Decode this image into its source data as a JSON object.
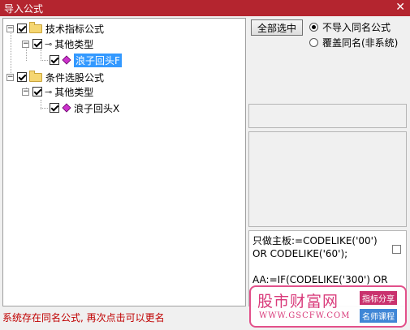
{
  "window": {
    "title": "导入公式",
    "close_glyph": "✕"
  },
  "tree": {
    "nodes": [
      {
        "label": "技术指标公式",
        "checked": true
      },
      {
        "label": "其他类型",
        "checked": true
      },
      {
        "label": "浪子回头F",
        "checked": true,
        "selected": true
      },
      {
        "label": "条件选股公式",
        "checked": true
      },
      {
        "label": "其他类型",
        "checked": true
      },
      {
        "label": "浪子回头X",
        "checked": true
      }
    ],
    "collapse_glyph": "−"
  },
  "buttons": {
    "select_all": "全部选中"
  },
  "radios": [
    {
      "label": "不导入同名公式",
      "selected": true
    },
    {
      "label": "覆盖同名(非系统)",
      "selected": false
    }
  ],
  "formula_preview": "只做主板:=CODELIKE('00')\nOR CODELIKE('60');\n\nAA:=IF(CODELIKE('300') OR",
  "status": "系统存在同名公式, 再次点击可以更名",
  "watermark": {
    "name": "股市财富网",
    "url": "WWW.GSCFW.COM",
    "tag1": "指标分享",
    "tag2": "名师课程"
  }
}
